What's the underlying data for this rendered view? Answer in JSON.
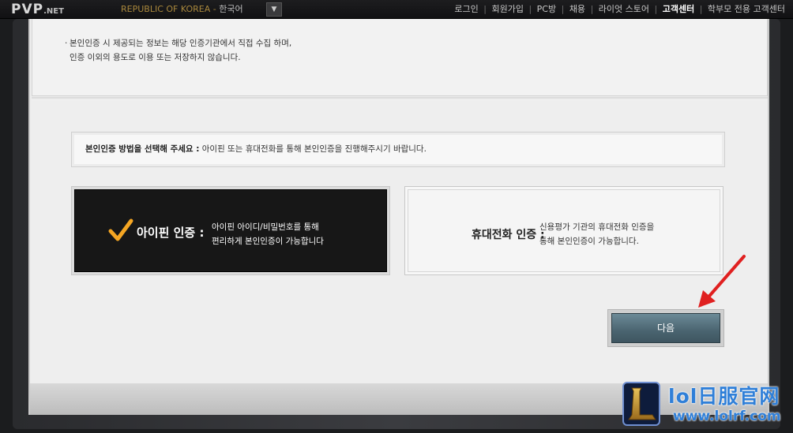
{
  "topbar": {
    "logo_main": "PVP",
    "logo_suffix": ".NET",
    "region": "REPUBLIC OF KOREA",
    "region_sep": " - ",
    "language": "한국어",
    "nav": {
      "login": "로그인",
      "signup": "회원가입",
      "pcbang": "PC방",
      "jobs": "채용",
      "store": "라이엇 스토어",
      "support": "고객센터",
      "parent_support": "학부모 전용 고객센터",
      "separator": "|"
    }
  },
  "notice": {
    "bullet": "·",
    "line1": "본인인증 시 제공되는 정보는 해당 인증기관에서 직접 수집 하며,",
    "line2": "인증 이외의 용도로 이용 또는 저장하지 않습니다."
  },
  "prompt": {
    "bold": "본인인증 방법을 선택해 주세요 :",
    "text": " 아이핀 또는 휴대전화를 통해 본인인증을 진행해주시기 바랍니다."
  },
  "options": {
    "ipin": {
      "title": "아이핀 인증 :",
      "desc_line1": "아이핀 아이디/비밀번호를 통해",
      "desc_line2": "편리하게 본인인증이 가능합니다"
    },
    "phone": {
      "title": "휴대전화 인증 :",
      "desc_line1": "신용평가 기관의 휴대전화 인증을",
      "desc_line2": "통해 본인인증이 가능합니다."
    }
  },
  "next_button": "다음",
  "watermark": {
    "title": "lol日服官网",
    "url": "www.lolrf.com",
    "logo_letter": "L"
  },
  "colors": {
    "accent_check": "#f5a623",
    "arrow": "#e02020",
    "watermark": "#2f7fd8"
  }
}
